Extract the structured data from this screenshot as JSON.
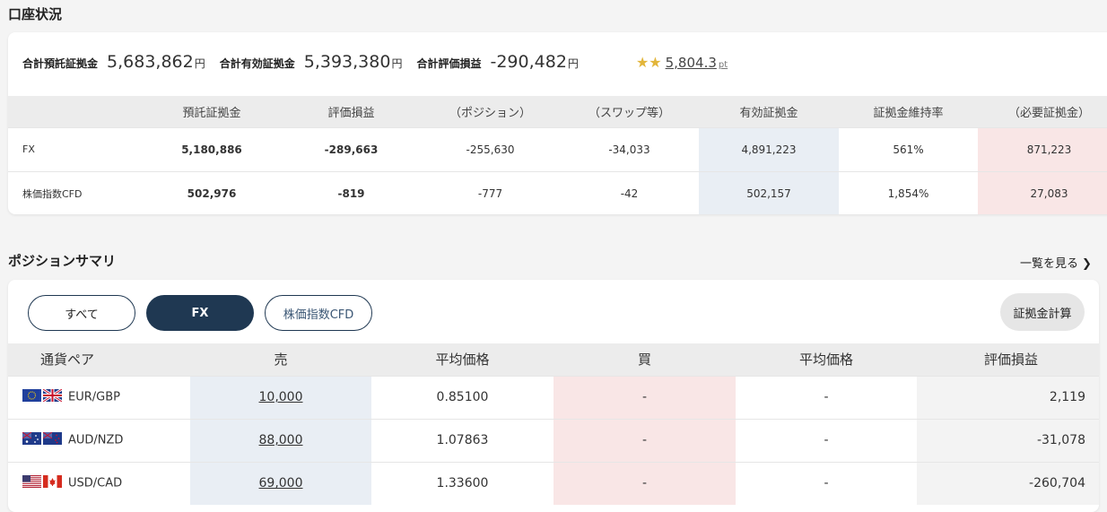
{
  "account": {
    "title": "口座状況",
    "summary": [
      {
        "label": "合計預託証拠金",
        "value": "5,683,862",
        "unit": "円"
      },
      {
        "label": "合計有効証拠金",
        "value": "5,393,380",
        "unit": "円"
      },
      {
        "label": "合計評価損益",
        "value": "-290,482",
        "unit": "円"
      }
    ],
    "stars": "★★",
    "points": "5,804.3",
    "points_unit": "pt",
    "table": {
      "headers": [
        "",
        "預託証拠金",
        "評価損益",
        "（ポジション）",
        "（スワップ等）",
        "有効証拠金",
        "証拠金維持率",
        "（必要証拠金）"
      ],
      "rows": [
        {
          "label": "FX",
          "deposit": "5,180,886",
          "pl": "-289,663",
          "position": "-255,630",
          "swap": "-34,033",
          "effective": "4,891,223",
          "ratio": "561%",
          "required": "871,223"
        },
        {
          "label": "株価指数CFD",
          "deposit": "502,976",
          "pl": "-819",
          "position": "-777",
          "swap": "-42",
          "effective": "502,157",
          "ratio": "1,854%",
          "required": "27,083"
        }
      ]
    }
  },
  "positions": {
    "title": "ポジションサマリ",
    "see_all": "一覧を見る",
    "filters": {
      "all": "すべて",
      "fx": "FX",
      "cfd": "株価指数CFD",
      "selected": "FX"
    },
    "calc_button": "証拠金計算",
    "headers": [
      "通貨ペア",
      "売",
      "平均価格",
      "買",
      "平均価格",
      "評価損益"
    ],
    "rows": [
      {
        "pair": "EUR/GBP",
        "flags": [
          "eu-flag",
          "uk-flag"
        ],
        "sell": "10,000",
        "sell_avg": "0.85100",
        "buy": "-",
        "buy_avg": "-",
        "pl": "2,119"
      },
      {
        "pair": "AUD/NZD",
        "flags": [
          "au-flag",
          "nz-flag"
        ],
        "sell": "88,000",
        "sell_avg": "1.07863",
        "buy": "-",
        "buy_avg": "-",
        "pl": "-31,078"
      },
      {
        "pair": "USD/CAD",
        "flags": [
          "us-flag",
          "ca-flag"
        ],
        "sell": "69,000",
        "sell_avg": "1.33600",
        "buy": "-",
        "buy_avg": "-",
        "pl": "-260,704"
      }
    ]
  },
  "colors": {
    "navy": "#1f3852",
    "sell_bg": "#e9eef4",
    "buy_bg": "#f9e6e6",
    "star": "#e2b53a"
  }
}
